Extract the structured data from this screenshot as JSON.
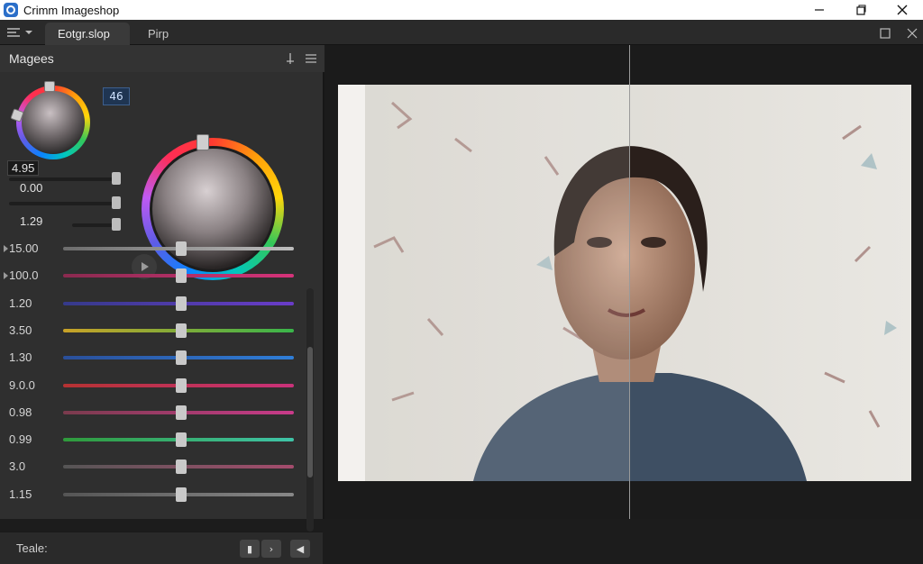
{
  "app": {
    "title": "Crimm Imageshop"
  },
  "tabs": [
    {
      "label": "Eotgr.slop"
    },
    {
      "label": "Pirp"
    }
  ],
  "panel": {
    "title": "Magees",
    "badge": "46",
    "top_values": [
      "4.95",
      "0.00",
      "1.29"
    ],
    "top_slider_levels": [
      0.95,
      1.0,
      1.0
    ],
    "rows": [
      {
        "label": "15.00",
        "level": 0.51,
        "colors": [
          "#6d6d6d",
          "#bdbdbd"
        ]
      },
      {
        "label": "100.0",
        "level": 0.51,
        "colors": [
          "#8a2a4f",
          "#d6337a"
        ]
      },
      {
        "label": "1.20",
        "level": 0.51,
        "colors": [
          "#353a8a",
          "#6a3cc9"
        ]
      },
      {
        "label": "3.50",
        "level": 0.51,
        "colors": [
          "#c9a227",
          "#39b54a"
        ]
      },
      {
        "label": "1.30",
        "level": 0.51,
        "colors": [
          "#2a4f9a",
          "#2f7ed8"
        ]
      },
      {
        "label": "9.0.0",
        "level": 0.51,
        "colors": [
          "#b53232",
          "#c9327a"
        ]
      },
      {
        "label": "0.98",
        "level": 0.51,
        "colors": [
          "#7a3b4d",
          "#c93b8a"
        ]
      },
      {
        "label": "0.99",
        "level": 0.51,
        "colors": [
          "#2f9a3b",
          "#3fc4a8"
        ]
      },
      {
        "label": "3.0",
        "level": 0.51,
        "colors": [
          "#555555",
          "#a54c6d"
        ]
      },
      {
        "label": "1.15",
        "level": 0.51,
        "colors": [
          "#555555",
          "#888888"
        ]
      }
    ],
    "footer_label": "Teale:"
  },
  "colors": {
    "accent": "#2b6fc9",
    "panel": "#2f2f2f",
    "canvas": "#1b1b1b"
  },
  "icons": [
    "app-icon",
    "minimize-icon",
    "maximize-icon",
    "close-icon",
    "menu-icon",
    "pin-icon",
    "list-icon",
    "play-icon",
    "restore-icon",
    "tab-close-icon"
  ]
}
